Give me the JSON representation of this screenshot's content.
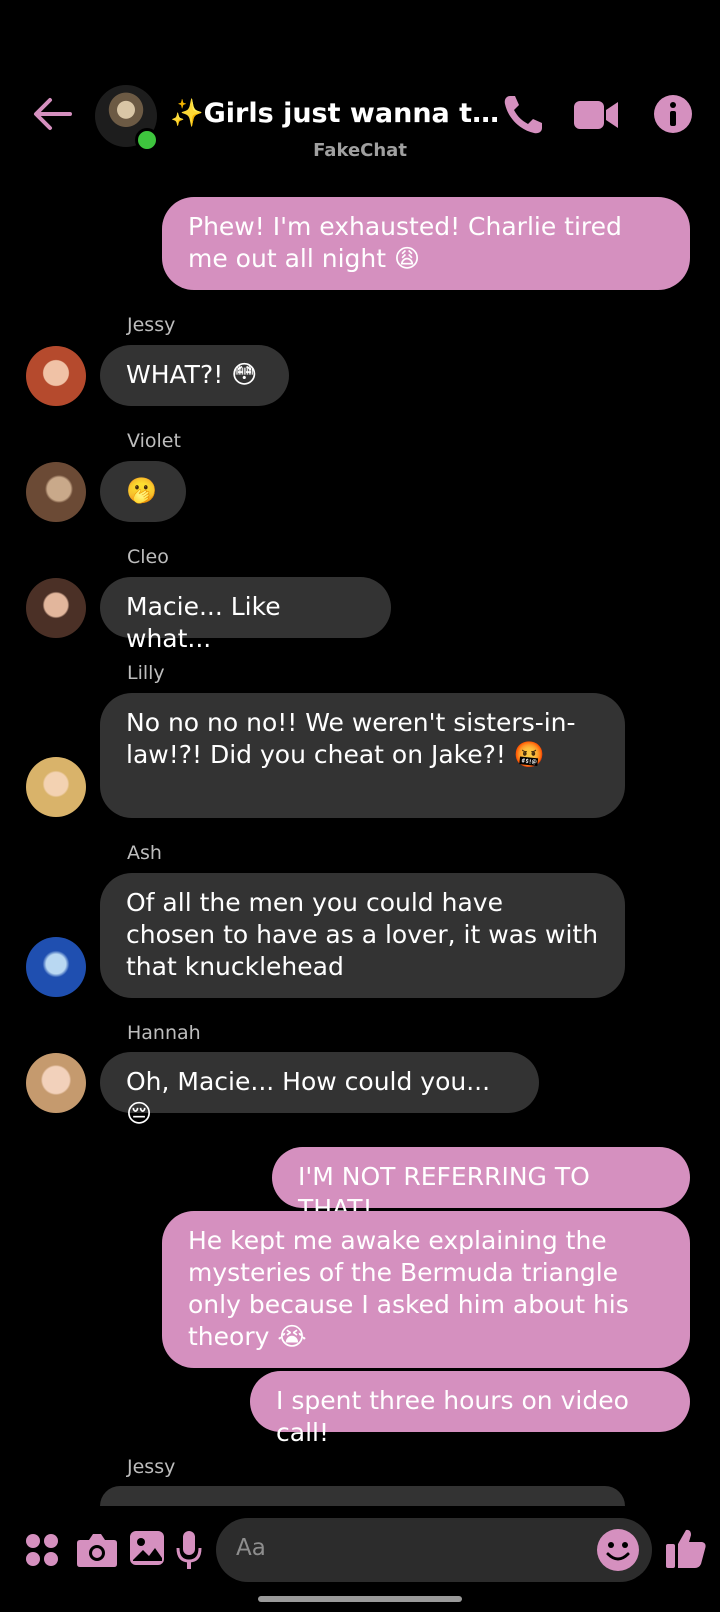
{
  "header": {
    "title": "✨Girls just wanna to have fun",
    "subtitle": "FakeChat"
  },
  "colors": {
    "accent": "#d590bf",
    "bubble_in": "#333333",
    "online": "#3ec53e"
  },
  "messages": [
    {
      "side": "out",
      "text": "Phew! I'm exhausted! Charlie tired me out all night 😩"
    },
    {
      "side": "in",
      "sender": "Jessy",
      "text": "WHAT?! 😳"
    },
    {
      "side": "in",
      "sender": "Violet",
      "text": "🫢"
    },
    {
      "side": "in",
      "sender": "Cleo",
      "text": "Macie... Like what..."
    },
    {
      "side": "in",
      "sender": "Lilly",
      "text": "No no no no!! We weren't sisters-in-law!?! Did you cheat on Jake?! 🤬"
    },
    {
      "side": "in",
      "sender": "Ash",
      "text": "Of all the men you could have chosen to have as a lover, it was with that knucklehead"
    },
    {
      "side": "in",
      "sender": "Hannah",
      "text": "Oh, Macie... How could you... 😔"
    },
    {
      "side": "out",
      "text": "I'M NOT REFERRING TO THAT!"
    },
    {
      "side": "out",
      "text": "He kept me awake explaining the mysteries of the Bermuda triangle only because I asked him about his theory 😭"
    },
    {
      "side": "out",
      "text": "I spent three hours on video call!"
    },
    {
      "side": "in",
      "sender": "Jessy",
      "text": ""
    }
  ],
  "composer": {
    "placeholder": "Aa"
  },
  "icons": [
    "back-arrow-icon",
    "phone-icon",
    "video-icon",
    "info-icon",
    "apps-icon",
    "camera-icon",
    "gallery-icon",
    "mic-icon",
    "emoji-icon",
    "thumbs-up-icon"
  ]
}
